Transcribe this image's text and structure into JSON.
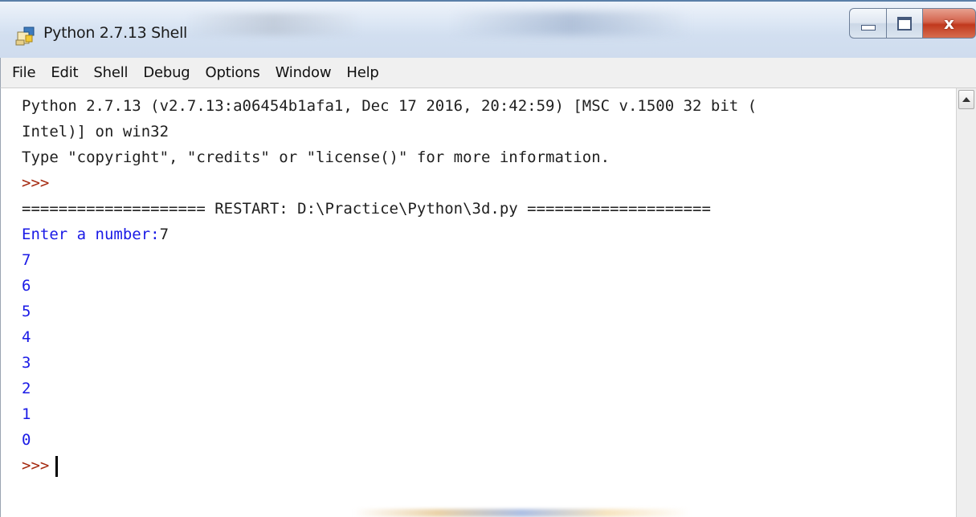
{
  "window": {
    "title": "Python 2.7.13 Shell",
    "close_label": "x"
  },
  "menu": {
    "items": [
      "File",
      "Edit",
      "Shell",
      "Debug",
      "Options",
      "Window",
      "Help"
    ]
  },
  "shell": {
    "banner_line1": "Python 2.7.13 (v2.7.13:a06454b1afa1, Dec 17 2016, 20:42:59) [MSC v.1500 32 bit (",
    "banner_line2": "Intel)] on win32",
    "banner_line3": "Type \"copyright\", \"credits\" or \"license()\" for more information.",
    "prompt": ">>>",
    "restart_line": "==================== RESTART: D:\\Practice\\Python\\3d.py ====================",
    "input_prompt": "Enter a number:",
    "input_value": "7",
    "outputs": [
      "7",
      "6",
      "5",
      "4",
      "3",
      "2",
      "1",
      "0"
    ],
    "final_prompt": ">>>"
  },
  "colors": {
    "stdout": "#1a1ae6",
    "prompt": "#a5290f",
    "text": "#1f1f1f"
  },
  "icons": {
    "app": "python-idle-icon",
    "minimize": "minimize-icon",
    "maximize": "maximize-icon",
    "close": "close-icon",
    "scroll_up": "scroll-up-arrow-icon"
  }
}
